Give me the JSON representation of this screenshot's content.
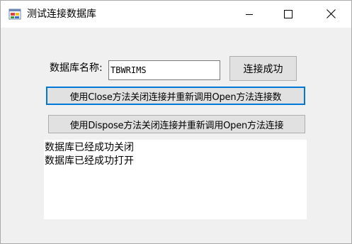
{
  "window": {
    "title": "测试连接数据库",
    "icon": "app-form-icon",
    "controls": [
      "minimize-icon",
      "maximize-icon",
      "close-icon"
    ]
  },
  "form": {
    "db_label": "数据库名称:",
    "db_value": "TBWRIMS",
    "status_button_label": "连接成功",
    "close_button_label": "使用Close方法关闭连接并重新调用Open方法连接数",
    "dispose_button_label": "使用Dispose方法关闭连接并重新调用Open方法连接"
  },
  "output": {
    "lines": [
      "数据库已经成功关闭",
      "数据库已经成功打开"
    ]
  },
  "colors": {
    "title_bg": "#ffffff",
    "form_bg": "#f0f0f0",
    "button_bg": "#e1e1e1",
    "focus_border": "#0078d7"
  }
}
